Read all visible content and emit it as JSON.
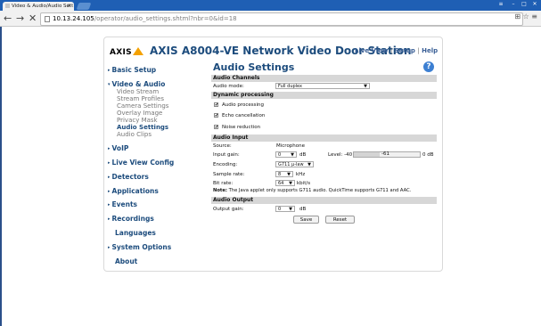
{
  "browser": {
    "tab_title": "Video & Audio/Audio Sett",
    "tab_close": "×",
    "url_host": "10.13.24.105",
    "url_path": "/operator/audio_settings.shtml?nbr=0&id=18",
    "back": "←",
    "forward": "→",
    "stop": "✕"
  },
  "header": {
    "logo_text": "AXIS",
    "product_title": "AXIS A8004-VE Network Video Door Station",
    "live_view": "Live View",
    "sep": "|",
    "setup": "Setup",
    "help": "Help"
  },
  "sidebar": {
    "basic_setup": "Basic Setup",
    "video_audio": "Video & Audio",
    "video_stream": "Video Stream",
    "stream_profiles": "Stream Profiles",
    "camera_settings": "Camera Settings",
    "overlay_image": "Overlay Image",
    "privacy_mask": "Privacy Mask",
    "audio_settings": "Audio Settings",
    "audio_clips": "Audio Clips",
    "voip": "VoIP",
    "live_view_config": "Live View Config",
    "detectors": "Detectors",
    "applications": "Applications",
    "events": "Events",
    "recordings": "Recordings",
    "languages": "Languages",
    "system_options": "System Options",
    "about": "About"
  },
  "main": {
    "title": "Audio Settings",
    "help_icon": "?",
    "audio_channels": {
      "header": "Audio Channels",
      "mode_label": "Audio mode:",
      "mode_value": "Full duplex"
    },
    "dynamic": {
      "header": "Dynamic processing",
      "audio_processing": "Audio processing",
      "echo_cancellation": "Echo cancellation",
      "noise_reduction": "Noise reduction",
      "checked_mark": "✔"
    },
    "audio_input": {
      "header": "Audio Input",
      "source_label": "Source:",
      "source_value": "Microphone",
      "gain_label": "Input gain:",
      "gain_value": "0",
      "gain_unit": "dB",
      "level_label": "Level: -40",
      "level_value": "-61",
      "level_max": "0 dB",
      "encoding_label": "Encoding:",
      "encoding_value": "G711 µ-law",
      "rate_label": "Sample rate:",
      "rate_value": "8",
      "rate_unit": "kHz",
      "bitrate_label": "Bit rate:",
      "bitrate_value": "64",
      "bitrate_unit": "kbit/s",
      "note_bold": "Note:",
      "note_text": " The Java applet only supports G711 audio. QuickTime supports G711 and AAC."
    },
    "audio_output": {
      "header": "Audio Output",
      "gain_label": "Output gain:",
      "gain_value": "0",
      "gain_unit": "dB"
    },
    "save": "Save",
    "reset": "Reset"
  }
}
